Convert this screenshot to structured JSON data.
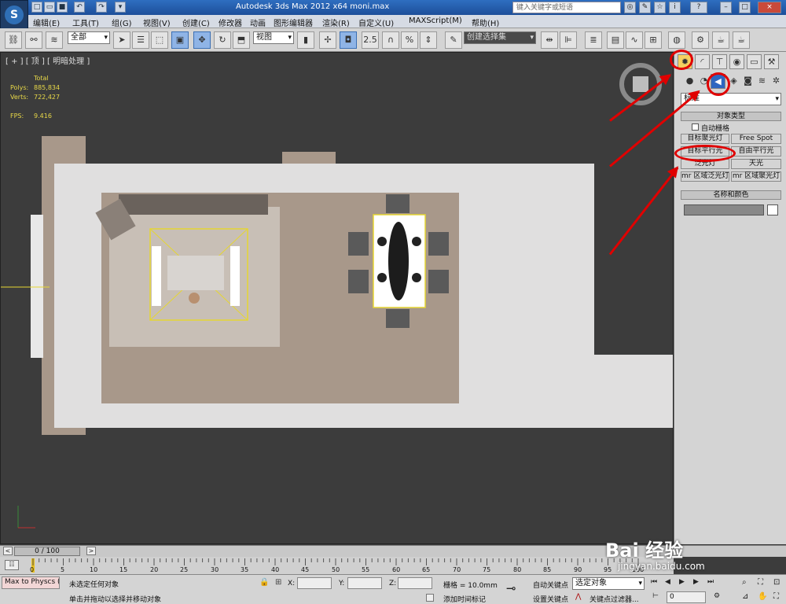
{
  "titlebar": {
    "app_title": "Autodesk 3ds Max  2012 x64      moni.max",
    "search_placeholder": "键入关键字或短语"
  },
  "menu": [
    "编辑(E)",
    "工具(T)",
    "组(G)",
    "视图(V)",
    "创建(C)",
    "修改器",
    "动画",
    "图形编辑器",
    "渲染(R)",
    "自定义(U)",
    "MAXScript(M)",
    "帮助(H)"
  ],
  "toolbar": {
    "selection_filter": "全部",
    "ref_coord": "视图",
    "selection_set": "创建选择集",
    "snap_25": "2.5",
    "percent_snap": "%"
  },
  "viewport": {
    "label": "[ + ] [ 顶 ] [ 明暗处理 ]",
    "stats": {
      "total_label": "Total",
      "polys_label": "Polys:",
      "polys": "885,834",
      "verts_label": "Verts:",
      "verts": "722,427",
      "fps_label": "FPS:",
      "fps": "9.416"
    }
  },
  "panel": {
    "category": "标准",
    "object_type_header": "对象类型",
    "autogrid": "自动栅格",
    "buttons": [
      "目标聚光灯",
      "Free Spot",
      "目标平行光",
      "自由平行光",
      "泛光灯",
      "天光",
      "mr 区域泛光灯",
      "mr 区域聚光灯"
    ],
    "name_color_header": "名称和颜色"
  },
  "timeline": {
    "frame": "0 / 100",
    "ticks": [
      "0",
      "5",
      "10",
      "15",
      "20",
      "25",
      "30",
      "35",
      "40",
      "45",
      "50",
      "55",
      "60",
      "65",
      "70",
      "75",
      "80",
      "85",
      "90",
      "95",
      "100"
    ]
  },
  "status": {
    "maxscript": "Max to Physcs (",
    "selection": "未选定任何对象",
    "prompt": "单击并拖动以选择并移动对象",
    "x_label": "X:",
    "y_label": "Y:",
    "z_label": "Z:",
    "grid": "栅格 = 10.0mm",
    "add_time_tag": "添加时间标记",
    "auto_key": "自动关键点",
    "set_key": "设置关键点",
    "key_mode": "选定对象",
    "key_filters": "关键点过滤器...",
    "frame_field": "0"
  },
  "watermark": {
    "brand": "Bai 经验",
    "url": "jingyan.baidu.com"
  },
  "colors": {
    "accent_red": "#e00000",
    "floor_light": "#e0dfdf",
    "floor_tan": "#a8988a",
    "viewport_bg": "#3c3c3c"
  }
}
